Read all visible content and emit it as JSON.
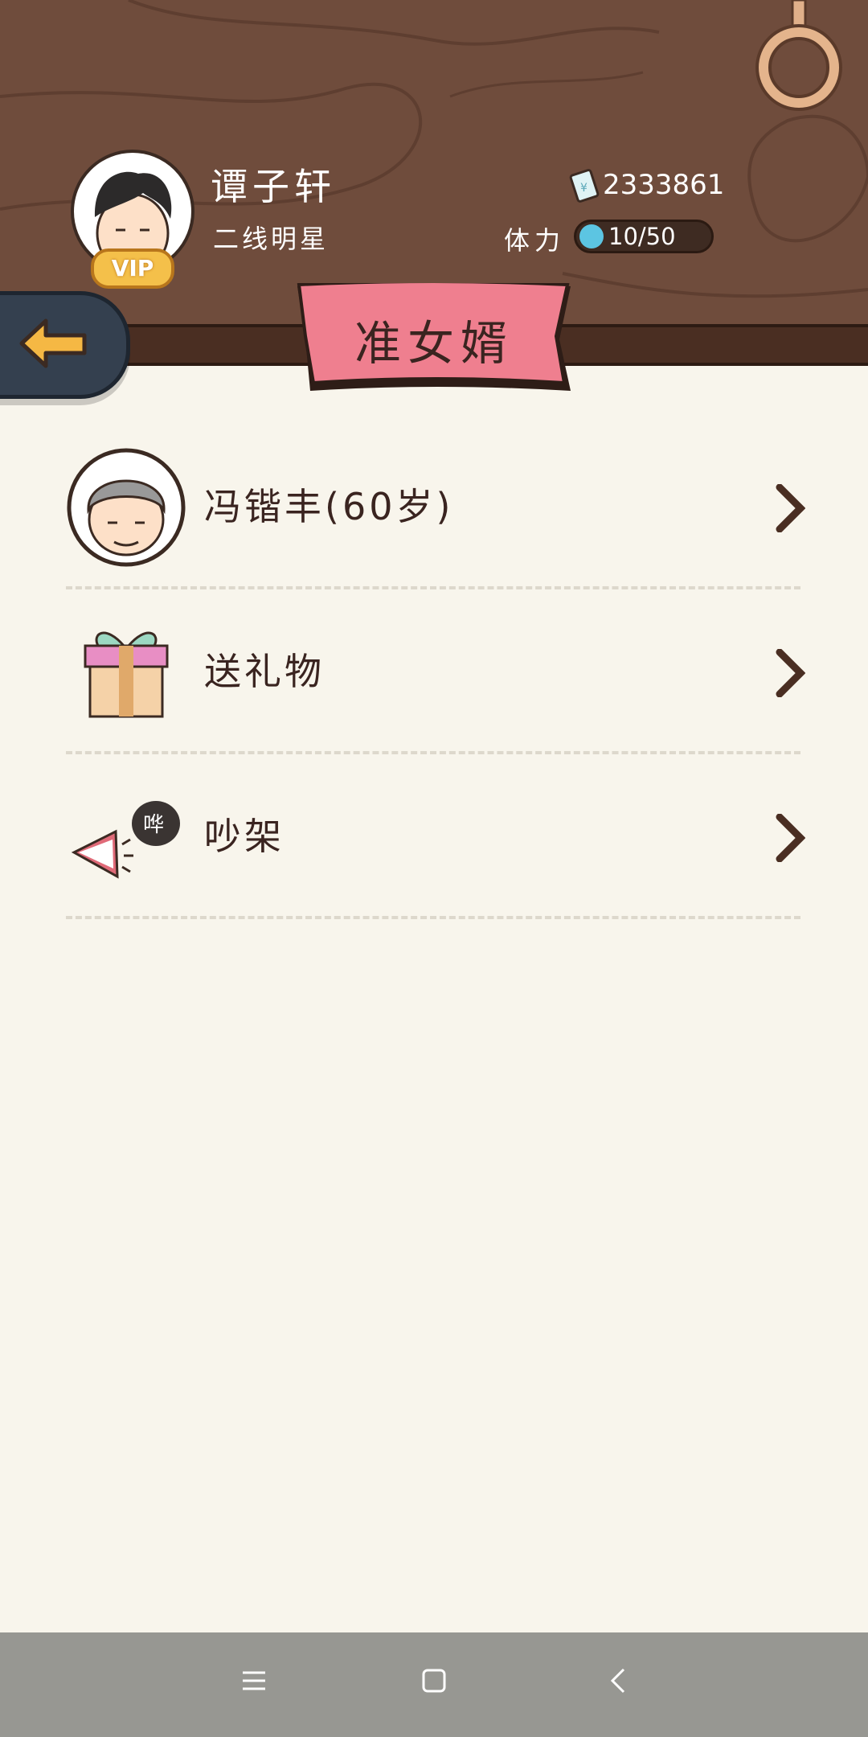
{
  "player": {
    "name": "谭子轩",
    "title": "二线明星",
    "vip_label": "VIP",
    "money": "2333861",
    "stamina_label": "体力",
    "stamina": "10/50"
  },
  "page": {
    "title": "准女婿"
  },
  "items": [
    {
      "label": "冯锴丰(60岁)",
      "icon": "elder-avatar-icon"
    },
    {
      "label": "送礼物",
      "icon": "gift-icon"
    },
    {
      "label": "吵架",
      "icon": "quarrel-icon",
      "badge": "哗"
    }
  ],
  "colors": {
    "wood": "#6f4c3c",
    "band": "#4a2e22",
    "ribbon": "#ef7f8f",
    "background": "#f8f5ec",
    "stamina": "#5cc5e2",
    "navbar": "#979792"
  }
}
